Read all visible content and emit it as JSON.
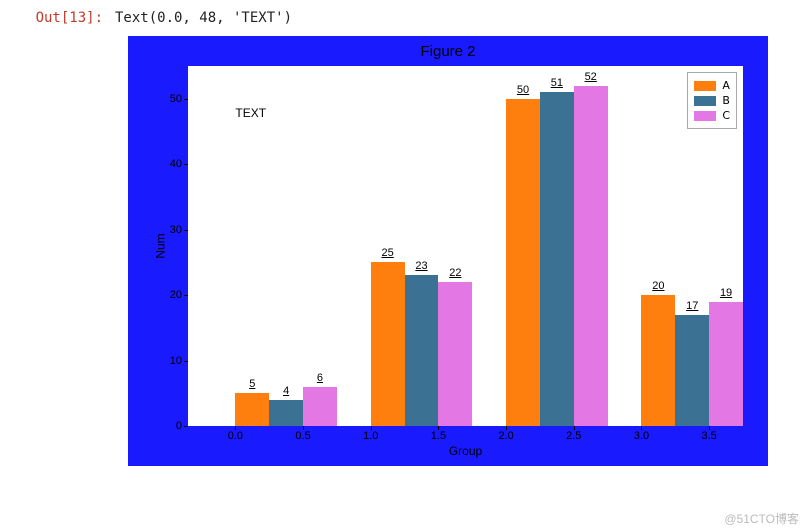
{
  "output_label": "Out[13]:",
  "output_text": "Text(0.0, 48, 'TEXT')",
  "chart_data": {
    "type": "bar",
    "title": "Figure 2",
    "xlabel": "Group",
    "ylabel": "Num",
    "annotation": "TEXT",
    "xticks": [
      "0.0",
      "0.5",
      "1.0",
      "1.5",
      "2.0",
      "2.5",
      "3.0",
      "3.5"
    ],
    "yticks": [
      0,
      10,
      20,
      30,
      40,
      50
    ],
    "ylim": [
      0,
      55
    ],
    "categories": [
      0,
      1,
      2,
      3
    ],
    "series": [
      {
        "name": "A",
        "color": "#ff7f0e",
        "values": [
          5,
          25,
          50,
          20
        ]
      },
      {
        "name": "B",
        "color": "#3b7193",
        "values": [
          4,
          23,
          51,
          17
        ]
      },
      {
        "name": "C",
        "color": "#e377e3",
        "values": [
          6,
          22,
          52,
          19
        ]
      }
    ],
    "legend_position": "upper right"
  },
  "watermark": "@51CTO博客"
}
